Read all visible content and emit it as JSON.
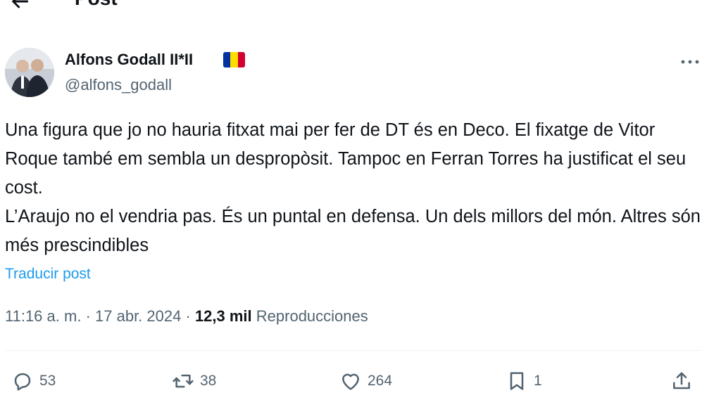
{
  "header": {
    "title": "Post",
    "back_icon": "arrow-left-icon"
  },
  "author": {
    "name": "Alfons Godall II*II",
    "handle": "@alfons_godall",
    "flag_colors": [
      "#0032a0",
      "#fedd00",
      "#d50032"
    ]
  },
  "post": {
    "paragraphs": [
      "Una figura que jo no hauria fitxat mai per fer de DT és en Deco. El fixatge de Vitor Roque també em sembla un despropòsit. Tampoc en Ferran Torres ha justificat el seu cost.",
      "L’Araujo no el vendria pas. És un puntal en defensa. Un dels millors del món. Altres són més prescindibles"
    ],
    "translate_label": "Traducir post"
  },
  "meta": {
    "time": "11:16 a. m.",
    "date": "17 abr. 2024",
    "views_count": "12,3 mil",
    "views_label": "Reproducciones"
  },
  "actions": {
    "replies": "53",
    "reposts": "38",
    "likes": "264",
    "bookmarks": "1"
  },
  "colors": {
    "accent": "#1d9bf0",
    "secondary_text": "#536471",
    "primary_text": "#0f1419"
  }
}
